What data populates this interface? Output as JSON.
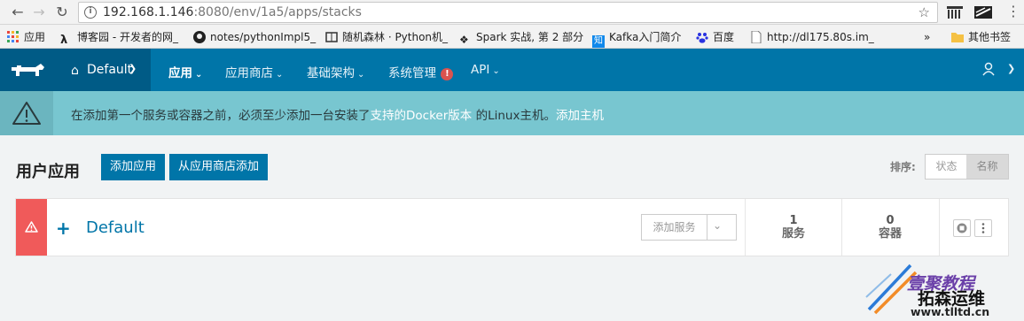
{
  "browser": {
    "url_host": "192.168.1.146",
    "url_rest": ":8080/env/1a5/apps/stacks",
    "icons": [
      "back-icon",
      "forward-icon",
      "reload-icon",
      "info-icon",
      "star-icon",
      "menu-icon"
    ]
  },
  "bookmarks": [
    {
      "label": "应用",
      "icon": "apps-icon"
    },
    {
      "label": "博客园 - 开发者的网_",
      "icon": "cnblogs-icon"
    },
    {
      "label": "notes/pythonImpl5_",
      "icon": "github-icon"
    },
    {
      "label": "随机森林 · Python机_",
      "icon": "book-icon"
    },
    {
      "label": "Spark 实战, 第 2 部分",
      "icon": "spark-icon"
    },
    {
      "label": "Kafka入门简介",
      "icon": "zhihu-icon"
    },
    {
      "label": "百度",
      "icon": "baidu-icon"
    },
    {
      "label": "http://dl175.80s.im_",
      "icon": "page-icon"
    },
    {
      "label": "»",
      "icon": ""
    },
    {
      "label": "其他书签",
      "icon": "folder-icon"
    }
  ],
  "topnav": {
    "env_label": "Default",
    "items": [
      {
        "label": "应用",
        "active": true
      },
      {
        "label": "应用商店",
        "active": false
      },
      {
        "label": "基础架构",
        "active": false
      },
      {
        "label": "系统管理",
        "active": false,
        "alert": "!"
      },
      {
        "label": "API",
        "active": false
      }
    ]
  },
  "banner": {
    "text_before": "在添加第一个服务或容器之前，必须至少添加一台安装了",
    "link_docker": "支持的Docker版本",
    "text_after": "的Linux主机。",
    "link_add_host": "添加主机"
  },
  "page": {
    "title": "用户应用",
    "add_app_button": "添加应用",
    "add_from_catalog_button": "从应用商店添加",
    "sort_label": "排序:",
    "sort_options": [
      "状态",
      "名称"
    ],
    "sort_selected": "名称"
  },
  "stack": {
    "expand_symbol": "+",
    "name": "Default",
    "add_service_button": "添加服务",
    "services_count": "1",
    "services_label": "服务",
    "containers_count": "0",
    "containers_label": "容器",
    "state_color": "#f05a5a"
  },
  "watermark": {
    "line1": "壹聚教程",
    "line2": "拓森运维",
    "url": "www.tlltd.cn"
  },
  "colors": {
    "primary": "#0075a8",
    "nav_dark": "#005b86",
    "banner_bg": "#78c6d0",
    "error": "#f05a5a"
  }
}
